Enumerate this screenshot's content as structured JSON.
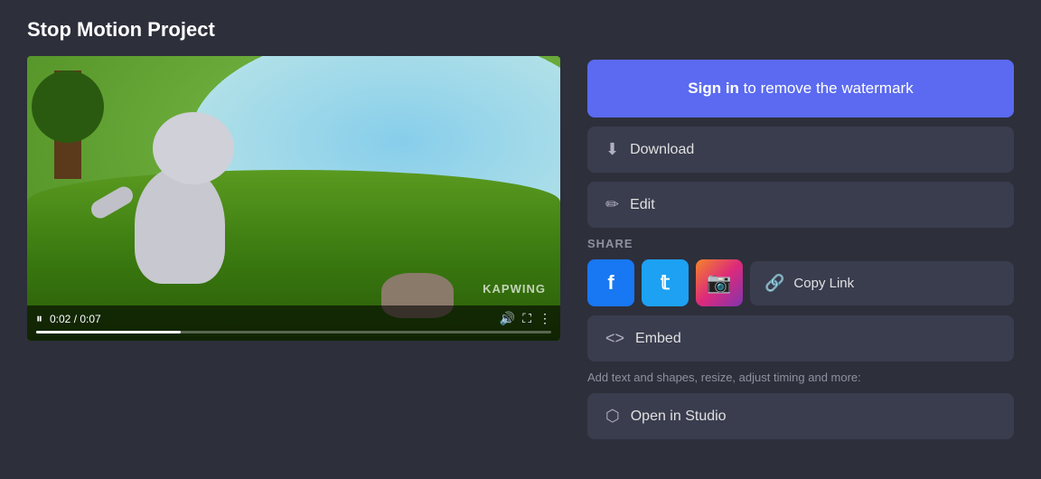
{
  "page": {
    "title": "Stop Motion Project",
    "background_color": "#2d2f3b"
  },
  "video": {
    "watermark": "KAPWING",
    "current_time": "0:02",
    "duration": "0:07",
    "progress_percent": 28
  },
  "actions": {
    "sign_in_label_bold": "Sign in",
    "sign_in_label_rest": " to remove the watermark",
    "download_label": "Download",
    "edit_label": "Edit",
    "share_label": "SHARE",
    "copy_link_label": "Copy Link",
    "embed_label": "Embed",
    "add_text_label": "Add text and shapes, resize, adjust timing and more:",
    "open_studio_label": "Open in Studio"
  },
  "icons": {
    "download": "⬇",
    "edit": "✏",
    "copy_link": "🔗",
    "embed": "<>",
    "open_studio": "⬡",
    "pause": "⏸",
    "volume": "🔊",
    "fullscreen": "⛶",
    "more": "⋮"
  },
  "social": {
    "facebook_label": "f",
    "twitter_label": "t",
    "instagram_label": "📷"
  }
}
